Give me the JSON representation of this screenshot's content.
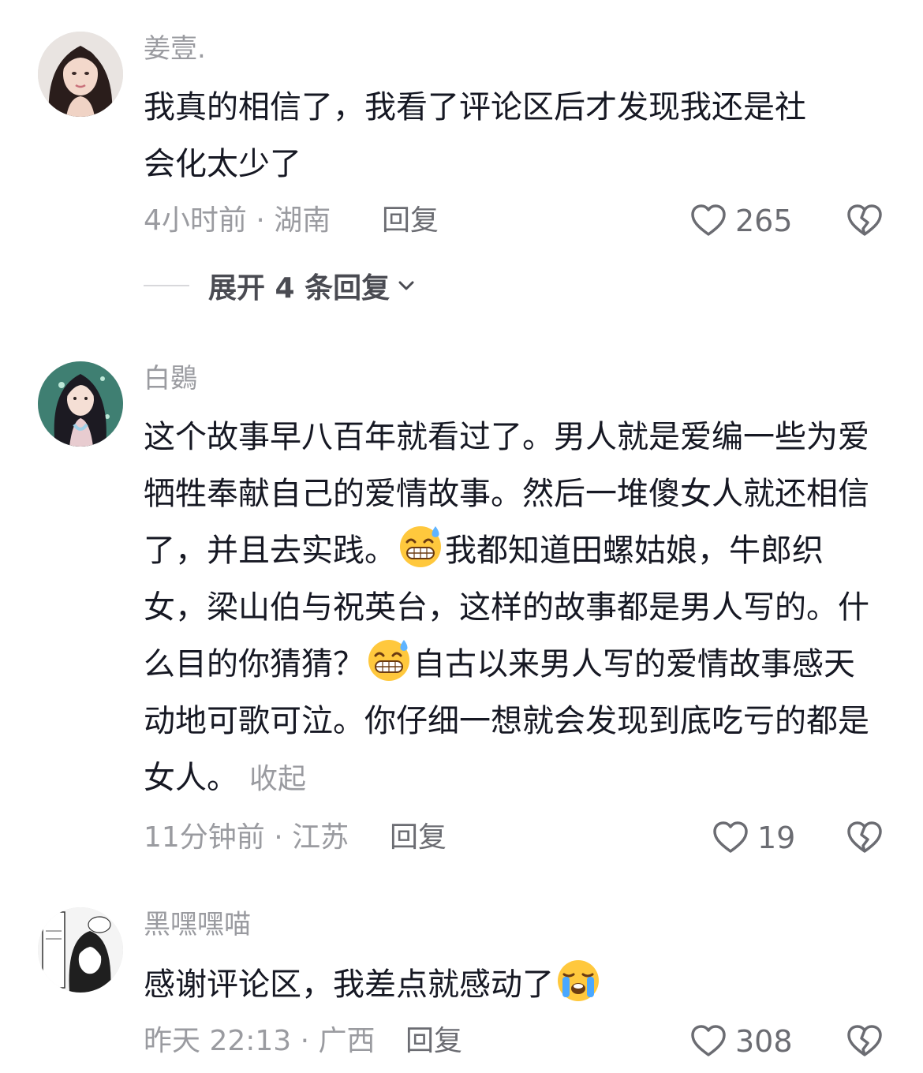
{
  "comments": [
    {
      "username": "姜壹.",
      "avatar": "avatar-woman-photo",
      "text_lines": [
        "我真的相信了，我看了评论区后才发现我还是社",
        "会化太少了"
      ],
      "time_location": "4小时前 · 湖南",
      "reply_label": "回复",
      "likes": "265",
      "expand_label": "展开 4 条回复"
    },
    {
      "username": "白鷃",
      "avatar": "avatar-anime-woman",
      "text_segments": [
        "这个故事早八百年就看过了。男人就是爱编一些为爱牺牲奉献自己的爱情故事。然后一堆傻女人就还相信了，并且去实践。",
        "我都知道田螺姑娘，牛郎织女，梁山伯与祝英台，这样的故事都是男人写的。什么目的你猜猜？",
        "自古以来男人写的爱情故事感天动地可歌可泣。你仔细一想就会发现到底吃亏的都是女人。"
      ],
      "emoji": "grinning-sweat-emoji",
      "collapse_label": "收起",
      "time_location": "11分钟前 · 江苏",
      "reply_label": "回复",
      "likes": "19"
    },
    {
      "username": "黑嘿嘿喵",
      "avatar": "avatar-manga-sketch",
      "text": "感谢评论区，我差点就感动了",
      "emoji": "crying-emoji",
      "time_location": "昨天 22:13 · 广西",
      "reply_label": "回复",
      "likes": "308"
    }
  ],
  "icons": {
    "like": "heart-icon",
    "dislike": "broken-heart-icon",
    "expand": "chevron-down-icon"
  }
}
